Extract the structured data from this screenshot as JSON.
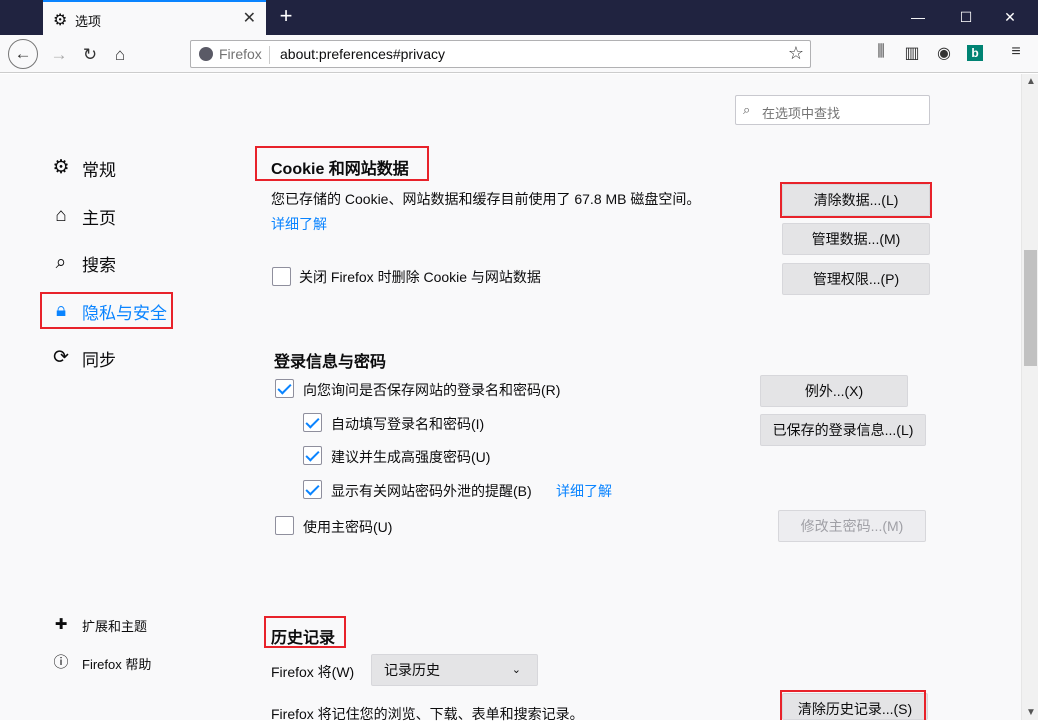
{
  "tab": {
    "title": "选项",
    "icon": "gear-icon"
  },
  "urlbar": {
    "identity": "Firefox",
    "url": "about:preferences#privacy"
  },
  "search": {
    "placeholder": "在选项中查找"
  },
  "sidebar": {
    "items": [
      {
        "label": "常规",
        "icon": "gear-icon"
      },
      {
        "label": "主页",
        "icon": "home-icon"
      },
      {
        "label": "搜索",
        "icon": "search-icon"
      },
      {
        "label": "隐私与安全",
        "icon": "lock-icon",
        "active": true
      },
      {
        "label": "同步",
        "icon": "sync-icon"
      }
    ],
    "footer": [
      {
        "label": "扩展和主题",
        "icon": "puzzle-icon"
      },
      {
        "label": "Firefox 帮助",
        "icon": "help-icon"
      }
    ]
  },
  "cookies": {
    "title": "Cookie 和网站数据",
    "usage": "您已存储的 Cookie、网站数据和缓存目前使用了 67.8 MB 磁盘空间。",
    "learn_more": "详细了解",
    "clear_button": "清除数据...(L)",
    "manage_button": "管理数据...(M)",
    "permissions_button": "管理权限...(P)",
    "delete_on_close": "关闭 Firefox 时删除 Cookie 与网站数据"
  },
  "logins": {
    "title": "登录信息与密码",
    "ask_save": "向您询问是否保存网站的登录名和密码(R)",
    "autofill": "自动填写登录名和密码(I)",
    "suggest": "建议并生成高强度密码(U)",
    "breach": "显示有关网站密码外泄的提醒(B)",
    "breach_learn": "详细了解",
    "master": "使用主密码(U)",
    "exceptions_button": "例外...(X)",
    "saved_button": "已保存的登录信息...(L)",
    "change_master_button": "修改主密码...(M)"
  },
  "history": {
    "title": "历史记录",
    "will_label": "Firefox 将(W)",
    "mode": "记录历史",
    "desc": "Firefox 将记住您的浏览、下载、表单和搜索记录。",
    "clear_button": "清除历史记录...(S)"
  },
  "colors": {
    "accent": "#0a84ff",
    "highlight": "#e8222a",
    "titlebar": "#202340"
  }
}
